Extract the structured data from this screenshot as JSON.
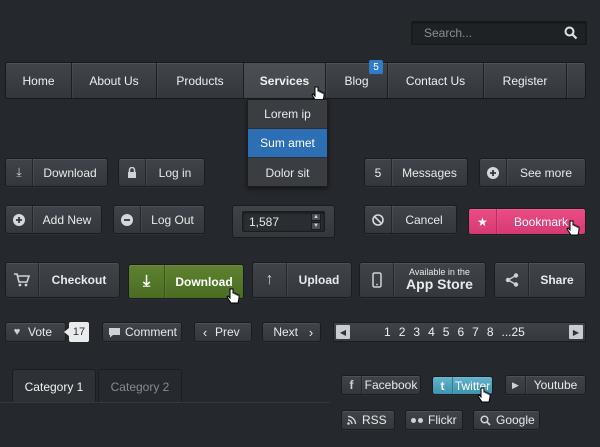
{
  "search": {
    "placeholder": "Search...",
    "value": ""
  },
  "nav": {
    "items": [
      {
        "label": "Home"
      },
      {
        "label": "About Us"
      },
      {
        "label": "Products"
      },
      {
        "label": "Services"
      },
      {
        "label": "Blog",
        "badge": "5"
      },
      {
        "label": "Contact Us"
      },
      {
        "label": "Register"
      }
    ],
    "active": "Services",
    "dropdown": [
      "Lorem ip",
      "Sum amet",
      "Dolor sit"
    ],
    "dropdown_selected": "Sum amet"
  },
  "row1": {
    "download": "Download",
    "login": "Log in",
    "messages_count": "5",
    "messages": "Messages",
    "see_more": "See more"
  },
  "row2": {
    "add_new": "Add New",
    "log_out": "Log Out",
    "stepper_value": "1,587",
    "cancel": "Cancel",
    "bookmark": "Bookmark"
  },
  "row3": {
    "checkout": "Checkout",
    "download": "Download",
    "upload": "Upload",
    "app_store_small": "Available in the",
    "app_store_big": "App Store",
    "share": "Share"
  },
  "row4": {
    "vote": "Vote",
    "vote_count": "17",
    "comment": "Comment",
    "prev": "Prev",
    "next": "Next",
    "pages": [
      "1",
      "2",
      "3",
      "4",
      "5",
      "6",
      "7",
      "8",
      "...25"
    ]
  },
  "tabs": [
    "Category 1",
    "Category 2"
  ],
  "social": {
    "facebook": "Facebook",
    "twitter": "Twitter",
    "youtube": "Youtube",
    "rss": "RSS",
    "flickr": "Flickr",
    "google": "Google"
  },
  "colors": {
    "background": "#25282c",
    "accent_blue": "#2d6fb5",
    "bookmark_pink": "#e8467f",
    "download_green": "#557a2a",
    "twitter_blue": "#4fa6bf"
  }
}
